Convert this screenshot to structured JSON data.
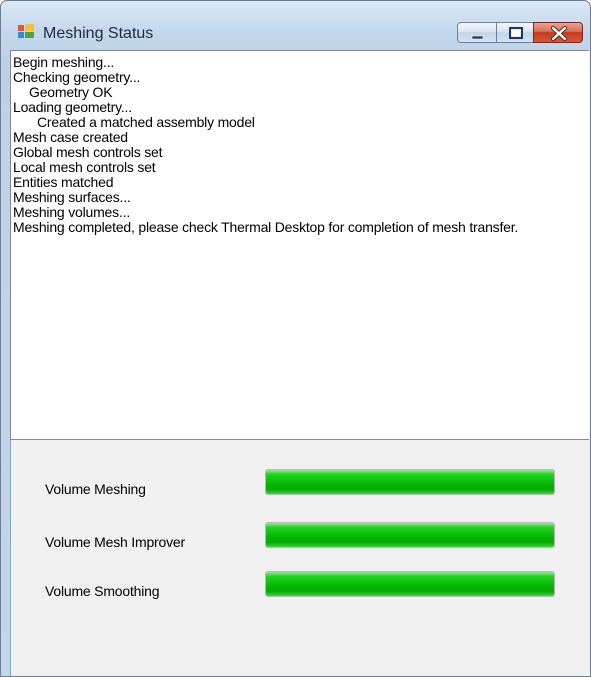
{
  "window": {
    "title": "Meshing Status",
    "icon": "windows-app-icon"
  },
  "titlebar_buttons": {
    "minimize": "minimize-icon",
    "maximize": "maximize-icon",
    "close": "close-icon"
  },
  "log": {
    "lines": [
      "Begin meshing...",
      "Checking geometry...",
      "Geometry OK",
      "Loading geometry...",
      "Created a matched assembly model",
      "Mesh case created",
      "Global mesh controls set",
      "Local mesh controls set",
      "Entities matched",
      "Meshing surfaces...",
      "Meshing volumes...",
      "Meshing completed, please check Thermal Desktop for completion of mesh transfer."
    ]
  },
  "progress": [
    {
      "label": "Volume Meshing",
      "fraction": 1.0
    },
    {
      "label": "Volume Mesh Improver",
      "fraction": 1.0
    },
    {
      "label": "Volume Smoothing",
      "fraction": 1.0
    }
  ],
  "colors": {
    "progress_fill": "#06b906",
    "close_button": "#c43a1f"
  }
}
